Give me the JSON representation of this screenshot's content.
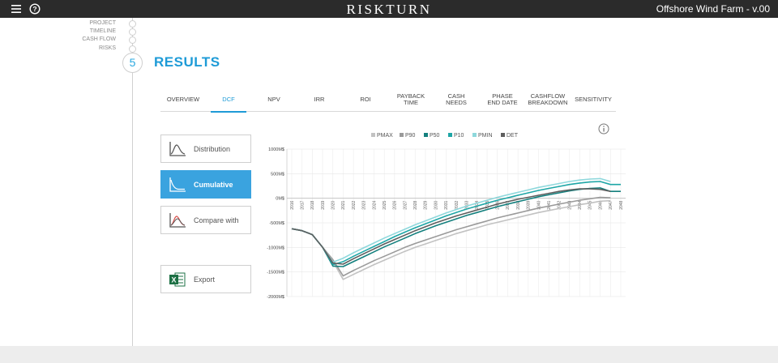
{
  "app": {
    "brand": "RISKTURN",
    "project_title": "Offshore Wind Farm - v.00"
  },
  "steps": [
    {
      "label": "PROJECT"
    },
    {
      "label": "TIMELINE"
    },
    {
      "label": "CASH FLOW"
    },
    {
      "label": "RISKS"
    }
  ],
  "current_step": {
    "number": "5",
    "title": "RESULTS"
  },
  "tabs": [
    {
      "label": "OVERVIEW",
      "active": false
    },
    {
      "label": "DCF",
      "active": true
    },
    {
      "label": "NPV",
      "active": false
    },
    {
      "label": "IRR",
      "active": false
    },
    {
      "label": "ROI",
      "active": false
    },
    {
      "label": "PAYBACK\nTIME",
      "active": false
    },
    {
      "label": "CASH\nNEEDS",
      "active": false
    },
    {
      "label": "PHASE\nEND DATE",
      "active": false
    },
    {
      "label": "CASHFLOW\nBREAKDOWN",
      "active": false
    },
    {
      "label": "SENSITIVITY",
      "active": false
    }
  ],
  "view_buttons": {
    "distribution": "Distribution",
    "cumulative": "Cumulative",
    "compare": "Compare with",
    "export": "Export"
  },
  "colors": {
    "accent": "#1e9bd7",
    "button_active": "#3aa3df",
    "topbar": "#2b2b2b"
  },
  "chart_data": {
    "type": "line",
    "title": "",
    "xlabel": "",
    "ylabel": "",
    "y_ticks": [
      "1000M$",
      "500M$",
      "0M$",
      "-500M$",
      "-1000M$",
      "-1500M$",
      "-2000M$"
    ],
    "y_tick_values": [
      1000,
      500,
      0,
      -500,
      -1000,
      -1500,
      -2000
    ],
    "ylim": [
      -2000,
      1000
    ],
    "x": [
      "2016",
      "2017",
      "2018",
      "2019",
      "2020",
      "2021",
      "2022",
      "2023",
      "2024",
      "2025",
      "2026",
      "2027",
      "2028",
      "2029",
      "2030",
      "2031",
      "2032",
      "2033",
      "2034",
      "2035",
      "2036",
      "2037",
      "2038",
      "2039",
      "2040",
      "2041",
      "2042",
      "2043",
      "2044",
      "2045",
      "2046",
      "2047",
      "2048"
    ],
    "grid": true,
    "legend_position": "top",
    "series": [
      {
        "name": "PMAX",
        "color": "#c2c2c2",
        "values": [
          -620,
          -660,
          -740,
          -1000,
          -1280,
          -1650,
          -1550,
          -1450,
          -1350,
          -1260,
          -1170,
          -1080,
          -1000,
          -930,
          -860,
          -790,
          -720,
          -660,
          -600,
          -540,
          -490,
          -440,
          -390,
          -340,
          -290,
          -250,
          -210,
          -170,
          -130,
          -100,
          -60,
          -50,
          null
        ]
      },
      {
        "name": "P90",
        "color": "#9a9a9a",
        "values": [
          -620,
          -660,
          -740,
          -1000,
          -1250,
          -1580,
          -1470,
          -1370,
          -1270,
          -1180,
          -1090,
          -1000,
          -920,
          -850,
          -780,
          -710,
          -640,
          -580,
          -520,
          -460,
          -400,
          -350,
          -300,
          -250,
          -200,
          -160,
          -120,
          -80,
          -40,
          -10,
          20,
          10,
          null
        ]
      },
      {
        "name": "P50",
        "color": "#14807e",
        "values": [
          -620,
          -660,
          -740,
          -1000,
          -1380,
          -1390,
          -1290,
          -1190,
          -1090,
          -990,
          -900,
          -810,
          -720,
          -640,
          -560,
          -490,
          -420,
          -350,
          -290,
          -230,
          -170,
          -120,
          -70,
          -20,
          30,
          70,
          110,
          150,
          180,
          200,
          210,
          140,
          140
        ]
      },
      {
        "name": "P10",
        "color": "#1ea6a6",
        "values": [
          -620,
          -660,
          -740,
          -1000,
          -1350,
          -1290,
          -1180,
          -1080,
          -980,
          -880,
          -780,
          -690,
          -600,
          -520,
          -440,
          -360,
          -290,
          -220,
          -160,
          -100,
          -40,
          10,
          60,
          110,
          160,
          200,
          240,
          280,
          310,
          330,
          340,
          280,
          280
        ]
      },
      {
        "name": "PMIN",
        "color": "#8ed8dc",
        "values": [
          -620,
          -660,
          -740,
          -1000,
          -1300,
          -1220,
          -1110,
          -1010,
          -910,
          -810,
          -720,
          -630,
          -540,
          -460,
          -380,
          -300,
          -230,
          -160,
          -100,
          -40,
          20,
          70,
          120,
          170,
          220,
          260,
          300,
          340,
          370,
          390,
          400,
          340,
          null
        ]
      },
      {
        "name": "DET",
        "color": "#5e5e5e",
        "values": [
          -620,
          -660,
          -740,
          -1000,
          -1320,
          -1340,
          -1230,
          -1130,
          -1030,
          -930,
          -840,
          -750,
          -660,
          -580,
          -500,
          -430,
          -360,
          -300,
          -240,
          -180,
          -120,
          -70,
          -20,
          20,
          60,
          100,
          140,
          170,
          190,
          190,
          180,
          140,
          null
        ]
      }
    ]
  }
}
